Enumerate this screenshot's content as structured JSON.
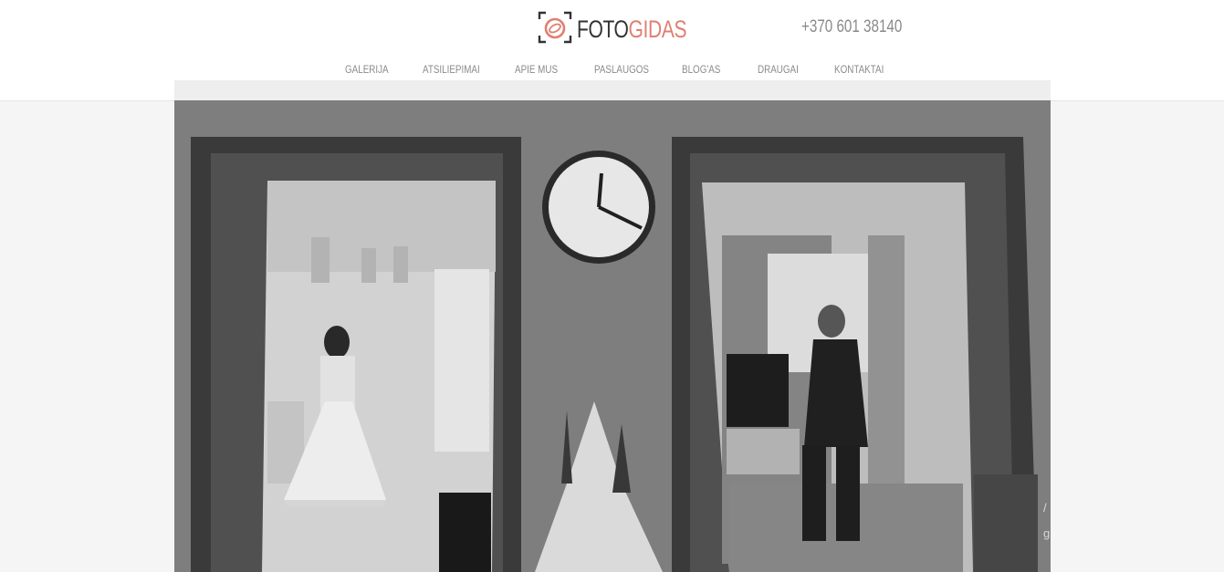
{
  "brand": {
    "name_part1": "FOTO",
    "name_part2": "GIDAS",
    "accent_color": "#e07f70"
  },
  "header": {
    "phone": "+370 601 38140"
  },
  "nav": {
    "items": [
      {
        "label": "GALERIJA"
      },
      {
        "label": "ATSILIEPIMAI"
      },
      {
        "label": "APIE MUS"
      },
      {
        "label": "PASLAUGOS"
      },
      {
        "label": "BLOG'AS"
      },
      {
        "label": "DRAUGAI"
      },
      {
        "label": "KONTAKTAI"
      }
    ]
  },
  "icons": {
    "logo": "camera-viewfinder-icon"
  }
}
